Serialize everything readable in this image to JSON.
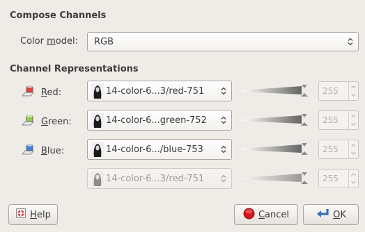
{
  "title": "Compose Channels",
  "color_model": {
    "label_pre": "Color ",
    "label_ul": "m",
    "label_post": "odel:",
    "value": "RGB"
  },
  "channel_section_title": "Channel Representations",
  "channels": [
    {
      "label_ul": "R",
      "label_rest": "ed:",
      "source": "14-color-6...3/red-751",
      "value": "255",
      "icon": "red-channel-icon",
      "color": "#e5413d",
      "disabled": false
    },
    {
      "label_ul": "G",
      "label_rest": "reen:",
      "source": "14-color-6...green-752",
      "value": "255",
      "icon": "green-channel-icon",
      "color": "#8ed04b",
      "disabled": false
    },
    {
      "label_ul": "B",
      "label_rest": "lue:",
      "source": "14-color-6.../blue-753",
      "value": "255",
      "icon": "blue-channel-icon",
      "color": "#3f80d5",
      "disabled": false
    },
    {
      "label_ul": "",
      "label_rest": "",
      "source": "14-color-6...3/red-751",
      "value": "255",
      "icon": "",
      "color": "#cccccc",
      "disabled": true
    }
  ],
  "buttons": {
    "help_ul": "H",
    "help_rest": "elp",
    "cancel_ul": "C",
    "cancel_rest": "ancel",
    "ok_ul": "O",
    "ok_rest": "K"
  }
}
